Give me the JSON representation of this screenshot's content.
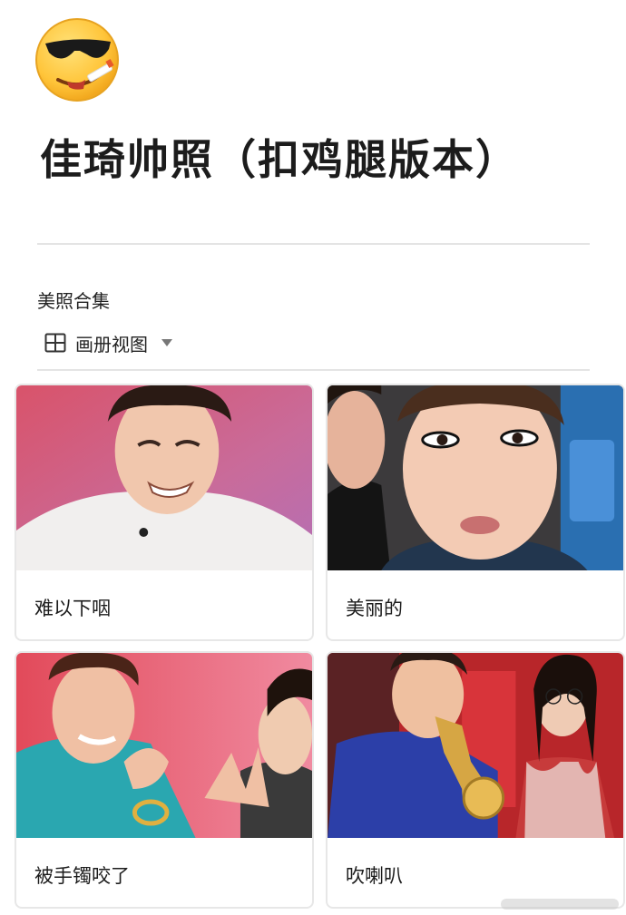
{
  "page": {
    "icon": "sunglasses-cigarette-emoji-icon",
    "title": "佳琦帅照（扣鸡腿版本）"
  },
  "gallery": {
    "section_title": "美照合集",
    "view_label": "画册视图",
    "view_icon": "gallery-grid-icon",
    "dropdown_icon": "caret-down-icon",
    "cards": [
      {
        "caption": "难以下咽"
      },
      {
        "caption": "美丽的"
      },
      {
        "caption": "被手镯咬了"
      },
      {
        "caption": "吹喇叭"
      }
    ]
  },
  "colors": {
    "divider": "#e4e4e4",
    "card_border": "#e7e7e7",
    "text": "#1c1c1c",
    "emoji_face": "#ffc83d"
  }
}
